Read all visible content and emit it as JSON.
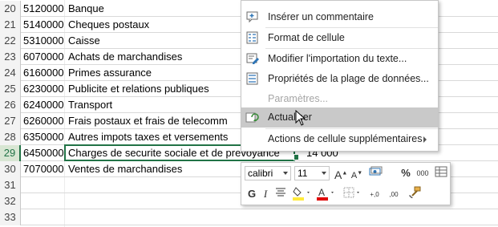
{
  "sheet": {
    "rows": [
      {
        "num": "20",
        "a": "5120000",
        "b": "Banque"
      },
      {
        "num": "21",
        "a": "5140000",
        "b": "Cheques postaux"
      },
      {
        "num": "22",
        "a": "5310000",
        "b": "Caisse"
      },
      {
        "num": "23",
        "a": "6070000",
        "b": "Achats de marchandises"
      },
      {
        "num": "24",
        "a": "6160000",
        "b": "Primes assurance"
      },
      {
        "num": "25",
        "a": "6230000",
        "b": "Publicite et relations publiques"
      },
      {
        "num": "26",
        "a": "6240000",
        "b": "Transport"
      },
      {
        "num": "27",
        "a": "6260000",
        "b": "Frais postaux et frais de telecomm"
      },
      {
        "num": "28",
        "a": "6350000",
        "b": "Autres impots taxes et versements"
      },
      {
        "num": "29",
        "a": "6450000",
        "b": "Charges de securite sociale et de prevoyance",
        "c": "14 000"
      },
      {
        "num": "30",
        "a": "7070000",
        "b": "Ventes de marchandises"
      },
      {
        "num": "31",
        "a": "",
        "b": ""
      },
      {
        "num": "32",
        "a": "",
        "b": ""
      },
      {
        "num": "33",
        "a": "",
        "b": ""
      }
    ]
  },
  "context_menu": {
    "items": [
      {
        "label": "Insérer un commentaire",
        "icon": "comment-icon"
      },
      {
        "label": "Format de cellule",
        "icon": "format-cells-icon"
      },
      {
        "label": "Modifier l'importation du texte...",
        "icon": "edit-import-icon"
      },
      {
        "label": "Propriétés de la plage de données...",
        "icon": "range-properties-icon"
      },
      {
        "label": "Paramètres...",
        "icon": "",
        "disabled": true
      },
      {
        "label": "Actualiser",
        "icon": "refresh-icon"
      },
      {
        "label": "Actions de cellule supplémentaires",
        "icon": ""
      }
    ]
  },
  "mini_toolbar": {
    "font": "calibri",
    "size": "11",
    "bold": "G",
    "italic": "I",
    "percent": "%",
    "thousands": "000",
    "inc_decimal": "+,0",
    "dec_decimal": ",00",
    "colors": {
      "fill": "#ffeb3b",
      "font": "#e00000",
      "accent": "#217346"
    }
  }
}
